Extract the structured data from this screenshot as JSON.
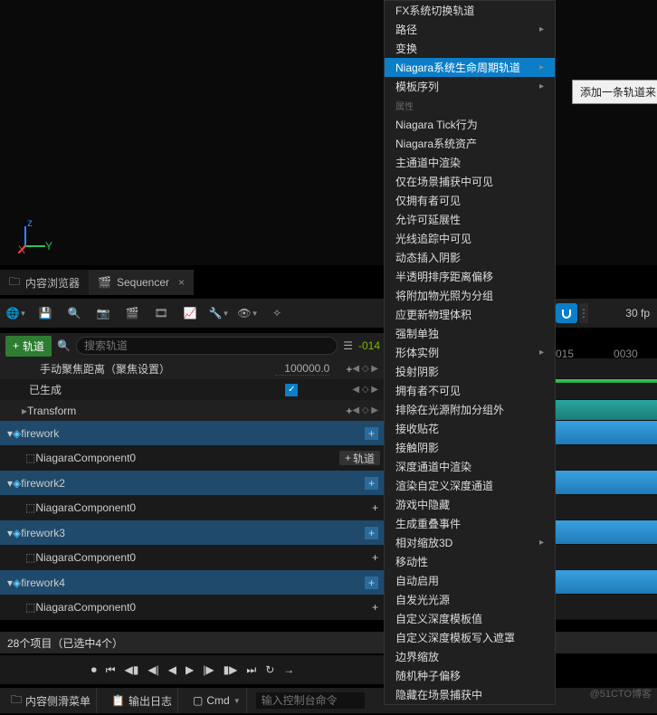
{
  "tabs": {
    "content_browser": "内容浏览器",
    "sequencer": "Sequencer"
  },
  "toolbar": {
    "fps": "30 fp"
  },
  "search": {
    "add_track": "轨道",
    "placeholder": "搜索轨道",
    "time": "-014"
  },
  "timeline_ticks": [
    "015",
    "0030"
  ],
  "tracks": {
    "manual_focus": {
      "label": "手动聚焦距离（聚焦设置）",
      "value": "100000.0"
    },
    "generated": "已生成",
    "transform": "Transform",
    "firework": "firework",
    "niagara": "NiagaraComponent0",
    "add_track_badge": "轨道",
    "firework2": "firework2",
    "firework3": "firework3",
    "firework4": "firework4"
  },
  "status": "28个项目（已选中4个）",
  "bottombar": {
    "slider_menu": "内容侧滑菜单",
    "output_log": "输出日志",
    "cmd": "Cmd",
    "cmd_ph": "输入控制台命令"
  },
  "watermark": "@51CTO博客",
  "tooltip": "添加一条轨道来",
  "context": {
    "g1": [
      "FX系统切换轨道",
      "路径",
      "变换",
      "Niagara系统生命周期轨道",
      "模板序列"
    ],
    "hdr": "属性",
    "g2": [
      "Niagara Tick行为",
      "Niagara系统资产",
      "主通道中渲染",
      "仅在场景捕获中可见",
      "仅拥有者可见",
      "允许可延展性",
      "光线追踪中可见",
      "动态插入阴影",
      "半透明排序距离偏移",
      "将附加物光照为分组",
      "应更新物理体积",
      "强制单独",
      "形体实例",
      "投射阴影",
      "拥有者不可见",
      "排除在光源附加分组外",
      "接收贴花",
      "接触阴影",
      "深度通道中渲染",
      "渲染自定义深度通道",
      "游戏中隐藏",
      "生成重叠事件",
      "相对缩放3D",
      "移动性",
      "自动启用",
      "自发光光源",
      "自定义深度模板值",
      "自定义深度模板写入遮罩",
      "边界缩放",
      "随机种子偏移",
      "隐藏在场景捕获中"
    ]
  },
  "context_submenu_idx": {
    "g1": [
      1,
      3,
      4
    ],
    "g2": [
      12,
      22
    ]
  }
}
